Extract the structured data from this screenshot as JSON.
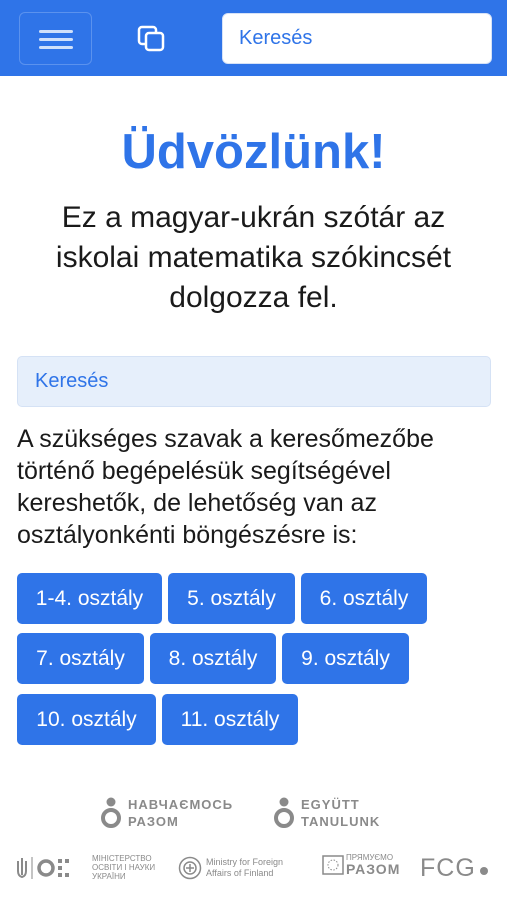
{
  "header": {
    "search_placeholder": "Keresés"
  },
  "welcome": {
    "title": "Üdvözlünk!",
    "intro": "Ez a magyar-ukrán szótár az iskolai matematika szókincsét dolgozza fel."
  },
  "search_panel": {
    "label": "Keresés"
  },
  "description": "A szükséges szavak a keresőmezőbe történő begépelésük segítségével kereshetők, de lehetőség van az osztályonkénti böngészésre is:",
  "grades": [
    "1-4. osztály",
    "5. osztály",
    "6. osztály",
    "7. osztály",
    "8. osztály",
    "9. osztály",
    "10. osztály",
    "11. osztály"
  ],
  "partners": {
    "navchaemos": [
      "НАВЧАЄМОСЬ",
      "РАЗОМ"
    ],
    "egyutt": [
      "EGYÜTT",
      "TANULUNK"
    ],
    "ministry_ua": [
      "МІНІСТЕРСТВО",
      "ОСВІТИ І НАУКИ",
      "УКРАЇНИ"
    ],
    "ministry_fi": [
      "Ministry for Foreign",
      "Affairs of Finland"
    ],
    "pryamuemo": [
      "ПРЯМУЄМО",
      "РАЗОМ"
    ],
    "fcg": "FCG"
  },
  "colors": {
    "accent": "#2f74e8",
    "panel": "#e6effb",
    "partner_gray": "#8a8a8a"
  }
}
